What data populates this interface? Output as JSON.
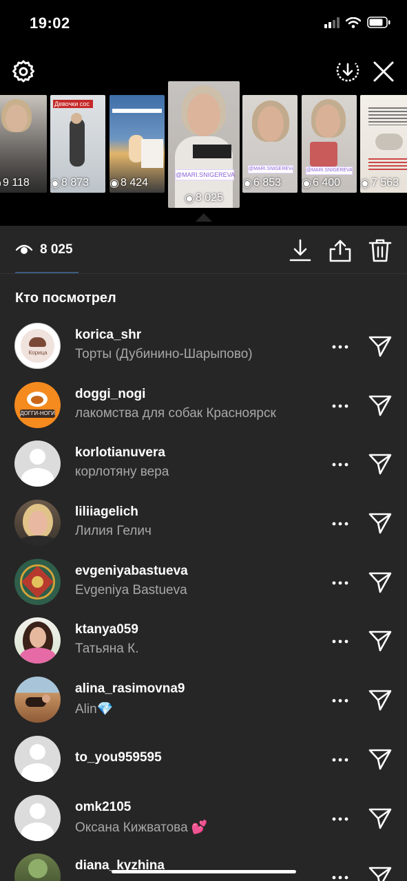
{
  "status_bar": {
    "time": "19:02",
    "icons": [
      "signal-icon",
      "wifi-icon",
      "battery-icon"
    ]
  },
  "top_controls": {
    "icons": [
      "gear-icon",
      "download-circle-icon",
      "close-icon"
    ]
  },
  "stories": [
    {
      "views": "9 118",
      "banner": ""
    },
    {
      "views": "8 873",
      "banner": "Девочки сос"
    },
    {
      "views": "8 424",
      "banner": ""
    },
    {
      "views": "8 025",
      "banner": "",
      "selected": true,
      "sticker": "@MARI.SNIGEREVA"
    },
    {
      "views": "6 853",
      "banner": "",
      "sticker": "@MARI.SNIGEREVA"
    },
    {
      "views": "6 400",
      "banner": "",
      "sticker": "@MARI.SNIGEREVA"
    },
    {
      "views": "7 563",
      "banner": ""
    }
  ],
  "panel": {
    "view_count": "8 025",
    "actions": [
      "download-icon",
      "share-icon",
      "trash-icon"
    ],
    "section_title": "Кто посмотрел"
  },
  "viewers": [
    {
      "username": "korica_shr",
      "fullname": "Торты (Дубинино-Шарыпово)",
      "avatar": "logo-korica"
    },
    {
      "username": "doggi_nogi",
      "fullname": "лакомства для собак Красноярск",
      "avatar": "logo-doggi"
    },
    {
      "username": "korlotianuvera",
      "fullname": "корлотяну вера",
      "avatar": "default"
    },
    {
      "username": "liliiagelich",
      "fullname": "Лилия Гелич",
      "avatar": "photo"
    },
    {
      "username": "evgeniyabastueva",
      "fullname": "Evgeniya Bastueva",
      "avatar": "mandala"
    },
    {
      "username": "ktanya059",
      "fullname": "Татьяна К.",
      "avatar": "photo"
    },
    {
      "username": "alina_rasimovna9",
      "fullname": "Alin💎",
      "avatar": "photo"
    },
    {
      "username": "to_you959595",
      "fullname": "",
      "avatar": "default"
    },
    {
      "username": "omk2105",
      "fullname": "Оксана Кижватова 💕",
      "avatar": "default"
    },
    {
      "username": "diana_kyzhina",
      "fullname": "",
      "avatar": "photo"
    }
  ],
  "colors": {
    "panel_bg": "#262626",
    "secondary_text": "#a8a8a8",
    "accent_underline": "#3a5b80"
  }
}
